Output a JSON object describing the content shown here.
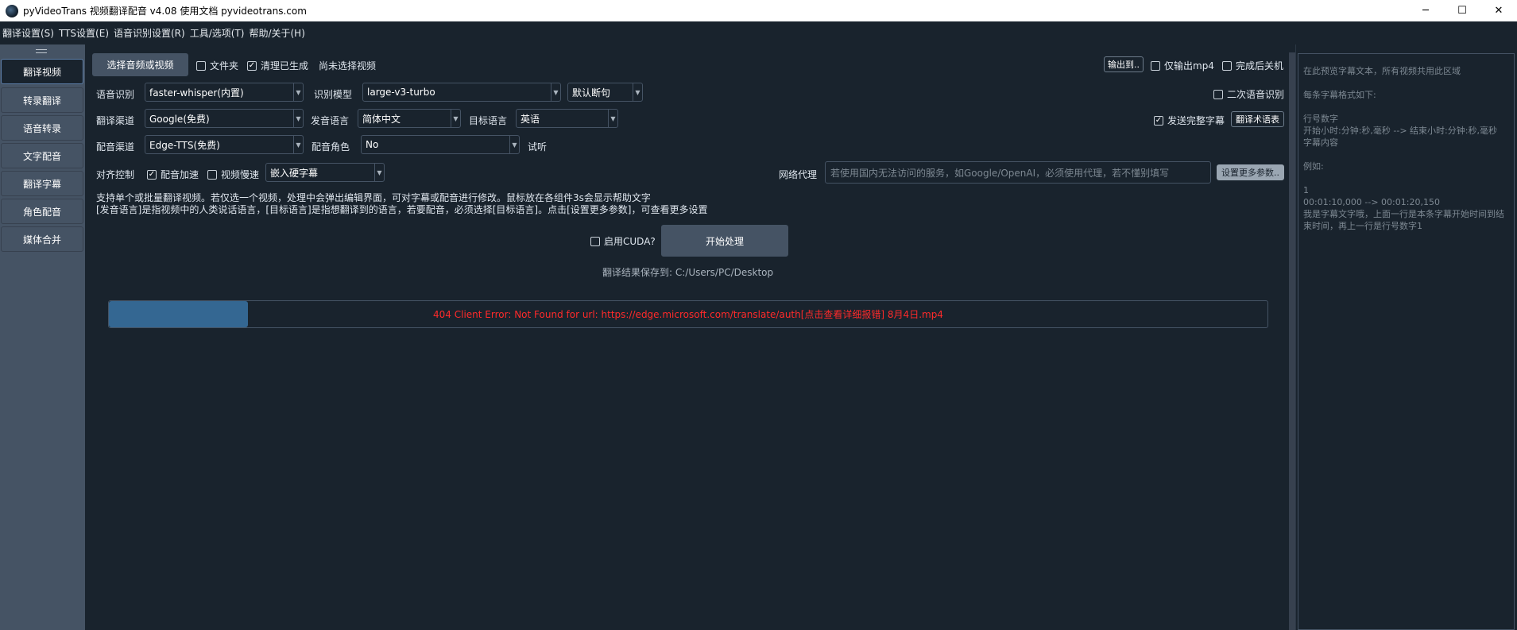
{
  "window": {
    "title": "pyVideoTrans 视频翻译配音 v4.08 使用文档 pyvideotrans.com",
    "minimize": "─",
    "maximize": "☐",
    "close": "✕"
  },
  "menu": [
    "翻译设置(S)",
    "TTS设置(E)",
    "语音识别设置(R)",
    "工具/选项(T)",
    "帮助/关于(H)"
  ],
  "nav": [
    {
      "label": "翻译视频"
    },
    {
      "label": "转录翻译"
    },
    {
      "label": "语音转录"
    },
    {
      "label": "文字配音"
    },
    {
      "label": "翻译字幕"
    },
    {
      "label": "角色配音"
    },
    {
      "label": "媒体合并"
    }
  ],
  "row1": {
    "select_media": "选择音频或视频",
    "folder": "文件夹",
    "clear_generated": "清理已生成",
    "no_video": "尚未选择视频",
    "output_to": "输出到..",
    "only_mp4": "仅输出mp4",
    "shutdown": "完成后关机"
  },
  "row2": {
    "asr_label": "语音识别",
    "asr_value": "faster-whisper(内置)",
    "model_label": "识别模型",
    "model_value": "large-v3-turbo",
    "split_value": "默认断句",
    "second_asr": "二次语音识别"
  },
  "row3": {
    "trans_label": "翻译渠道",
    "trans_value": "Google(免费)",
    "src_lang_label": "发音语言",
    "src_lang_value": "简体中文",
    "tgt_lang_label": "目标语言",
    "tgt_lang_value": "英语",
    "send_full": "发送完整字幕",
    "glossary": "翻译术语表"
  },
  "row4": {
    "tts_label": "配音渠道",
    "tts_value": "Edge-TTS(免费)",
    "role_label": "配音角色",
    "role_value": "No",
    "listen": "试听"
  },
  "row5": {
    "align_label": "对齐控制",
    "speedup": "配音加速",
    "slowdown": "视频慢速",
    "subtitle_value": "嵌入硬字幕",
    "proxy_label": "网络代理",
    "proxy_placeholder": "若使用国内无法访问的服务，如Google/OpenAI，必须使用代理，若不懂别填写",
    "more_params": "设置更多参数.."
  },
  "info": {
    "line1": "支持单个或批量翻译视频。若仅选一个视频，处理中会弹出编辑界面，可对字幕或配音进行修改。鼠标放在各组件3s会显示帮助文字",
    "line2": "[发音语言]是指视频中的人类说话语言，[目标语言]是指想翻译到的语言，若要配音，必须选择[目标语言]。点击[设置更多参数]，可查看更多设置"
  },
  "actions": {
    "cuda": "启用CUDA?",
    "start": "开始处理",
    "save_path": "翻译结果保存到: C:/Users/PC/Desktop"
  },
  "progress": {
    "fraction": 0.12,
    "message": "404 Client Error: Not Found for url: https://edge.microsoft.com/translate/auth[点击查看详细报错] 8月4日.mp4"
  },
  "subtitle_panel": {
    "text": "在此预览字幕文本，所有视频共用此区域\n\n每条字幕格式如下:\n\n行号数字\n开始小时:分钟:秒,毫秒 --> 结束小时:分钟:秒,毫秒\n字幕内容\n\n例如:\n\n1\n00:01:10,000 --> 00:01:20,150\n我是字幕文字哦，上面一行是本条字幕开始时间到结束时间，再上一行是行号数字1"
  }
}
